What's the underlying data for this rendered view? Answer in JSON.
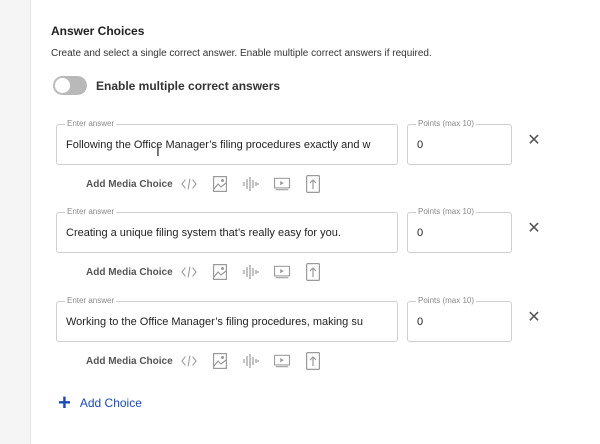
{
  "section": {
    "title": "Answer Choices",
    "subtitle": "Create and select a single correct answer. Enable multiple correct answers if required."
  },
  "toggle": {
    "label": "Enable multiple correct answers",
    "enabled": false
  },
  "field_labels": {
    "answer": "Enter answer",
    "points": "Points (max 10)"
  },
  "choices": [
    {
      "answer": "Following the Office Manager’s filing procedures exactly and w",
      "points": "0",
      "media_label": "Add Media Choice"
    },
    {
      "answer": "Creating a unique filing system that’s really easy for you.",
      "points": "0",
      "media_label": "Add Media Choice"
    },
    {
      "answer": "Working to the Office Manager’s filing procedures, making su",
      "points": "0",
      "media_label": "Add Media Choice"
    }
  ],
  "icons": {
    "media": [
      "code-icon",
      "image-icon",
      "audio-icon",
      "video-icon",
      "upload-icon"
    ],
    "remove": "close-icon",
    "add": "plus-icon"
  },
  "add_choice": {
    "label": "Add Choice"
  },
  "colors": {
    "accent": "#1c4ab5",
    "toggle_off": "#b9b9b9"
  }
}
